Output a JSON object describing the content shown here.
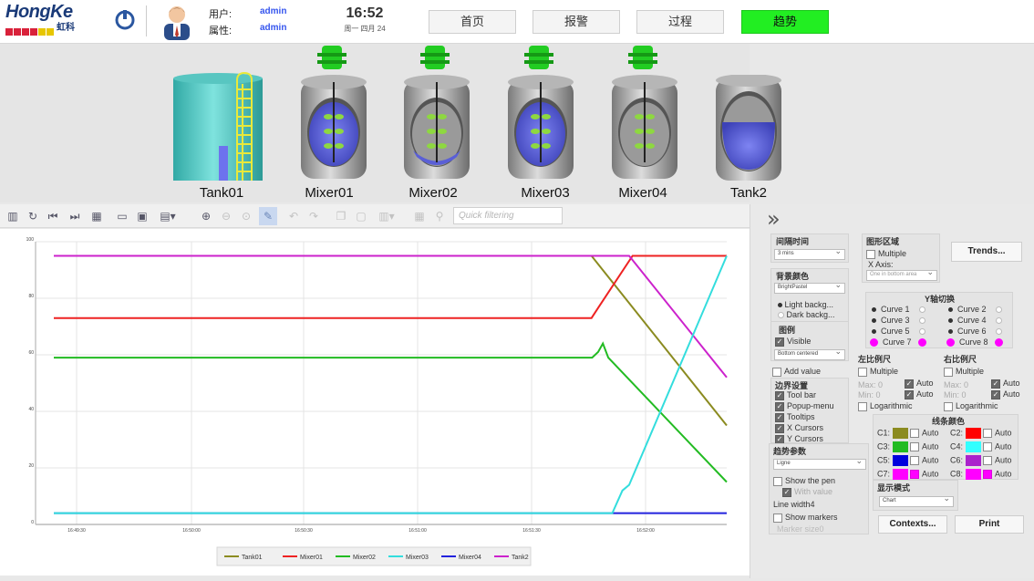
{
  "header": {
    "brand": "HongKe",
    "brand_cn": "虹科",
    "user_label": "用户:",
    "user_value": "admin",
    "attr_label": "属性:",
    "attr_value": "admin",
    "time": "16:52",
    "date": "周一 四月 24",
    "nav": [
      "首页",
      "报警",
      "过程",
      "趋势"
    ],
    "active_nav": "趋势",
    "brand_color": "#1a3a78",
    "active_color": "#22ee22"
  },
  "equipment": [
    "Tank01",
    "Mixer01",
    "Mixer02",
    "Mixer03",
    "Mixer04",
    "Tank2"
  ],
  "toolbar": {
    "search_placeholder": "Quick filtering"
  },
  "chart_data": {
    "type": "line",
    "x": [
      "16:49:30",
      "16:50:00",
      "16:50:30",
      "16:51:00",
      "16:51:30",
      "16:52:00"
    ],
    "y_ticks": [
      0,
      20,
      40,
      60,
      80,
      100
    ],
    "ylim": [
      0,
      100
    ],
    "grid": true,
    "legend_position": "bottom-center",
    "series": [
      {
        "name": "Tank01",
        "color": "#8b8b20",
        "points": [
          [
            0,
            95
          ],
          [
            0.799,
            95
          ],
          [
            1,
            35
          ]
        ]
      },
      {
        "name": "Mixer01",
        "color": "#ee2222",
        "points": [
          [
            0,
            73
          ],
          [
            0.799,
            73
          ],
          [
            0.81,
            77
          ],
          [
            0.86,
            95
          ],
          [
            1,
            95
          ]
        ]
      },
      {
        "name": "Mixer02",
        "color": "#22bb22",
        "points": [
          [
            0,
            59
          ],
          [
            0.8,
            59
          ],
          [
            0.809,
            61
          ],
          [
            0.816,
            64
          ],
          [
            0.824,
            59
          ],
          [
            1,
            15
          ]
        ]
      },
      {
        "name": "Mixer03",
        "color": "#33dddd",
        "points": [
          [
            0,
            4
          ],
          [
            0.83,
            4
          ],
          [
            0.845,
            12
          ],
          [
            0.855,
            14
          ],
          [
            1,
            95
          ]
        ]
      },
      {
        "name": "Mixer04",
        "color": "#2222dd",
        "points": [
          [
            0,
            4
          ],
          [
            1,
            4
          ]
        ]
      },
      {
        "name": "Tank2",
        "color": "#cc22cc",
        "points": [
          [
            0,
            95
          ],
          [
            0.799,
            95
          ],
          [
            0.855,
            95
          ],
          [
            1,
            52
          ]
        ]
      }
    ]
  },
  "panel": {
    "interval_title": "间隔时间",
    "interval_value": "3 mins",
    "area_title": "图形区域",
    "multiple": "Multiple",
    "xaxis": "X Axis:",
    "xaxis_value": "One in bottom area",
    "trends_btn": "Trends...",
    "bg_title": "背景颜色",
    "bg_value": "BrightPastel",
    "light_bg": "Light backg...",
    "dark_bg": "Dark backg...",
    "y_switch_title": "Y轴切换",
    "curves": [
      "Curve 1",
      "Curve 2",
      "Curve 3",
      "Curve 4",
      "Curve 5",
      "Curve 6",
      "Curve 7",
      "Curve 8"
    ],
    "legend_title": "图例",
    "visible": "Visible",
    "legend_pos": "Bottom centered",
    "left_scale": "左比例尺",
    "right_scale": "右比例尺",
    "max": "Max: 0",
    "min": "Min: 0",
    "auto": "Auto",
    "log": "Logarithmic",
    "add_value": "Add value",
    "border_title": "边界设置",
    "border_items": [
      "Tool bar",
      "Popup-menu",
      "Tooltips",
      "X Cursors",
      "Y Cursors"
    ],
    "line_color_title": "线条颜色",
    "colors": [
      {
        "label": "C1:",
        "hex": "#8b8b20",
        "auto": false
      },
      {
        "label": "C2:",
        "hex": "#ff0000",
        "auto": false
      },
      {
        "label": "C3:",
        "hex": "#22bb22",
        "auto": false
      },
      {
        "label": "C4:",
        "hex": "#33ffff",
        "auto": false
      },
      {
        "label": "C5:",
        "hex": "#0000dd",
        "auto": false
      },
      {
        "label": "C6:",
        "hex": "#aa22cc",
        "auto": false
      },
      {
        "label": "C7:",
        "hex": "#ff00ff",
        "auto": true
      },
      {
        "label": "C8:",
        "hex": "#ff00ff",
        "auto": true
      }
    ],
    "trend_param_title": "趋势参数",
    "trend_value": "Ligne",
    "show_pen": "Show the pen",
    "with_value": "With value",
    "line_width": "Line width4",
    "show_markers": "Show markers",
    "marker_size": "Marker size0",
    "display_title": "显示模式",
    "display_value": "Chart",
    "contexts_btn": "Contexts...",
    "print_btn": "Print"
  }
}
